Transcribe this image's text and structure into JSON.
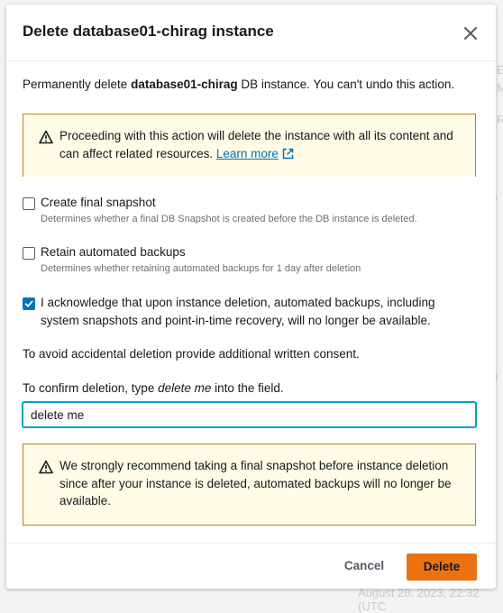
{
  "modal": {
    "title": "Delete database01-chirag instance",
    "intro_prefix": "Permanently delete ",
    "intro_instance": "database01-chirag",
    "intro_suffix": " DB instance. You can't undo this action.",
    "warning1": {
      "text": "Proceeding with this action will delete the instance with all its content and can affect related resources.",
      "link_label": "Learn more"
    },
    "options": [
      {
        "label": "Create final snapshot",
        "description": "Determines whether a final DB Snapshot is created before the DB instance is deleted.",
        "checked": false
      },
      {
        "label": "Retain automated backups",
        "description": "Determines whether retaining automated backups for 1 day after deletion",
        "checked": false
      },
      {
        "label": "I acknowledge that upon instance deletion, automated backups, including system snapshots and point-in-time recovery, will no longer be available.",
        "checked": true
      }
    ],
    "consent_text": "To avoid accidental deletion provide additional written consent.",
    "confirm_prefix": "To confirm deletion, type ",
    "confirm_phrase": "delete me",
    "confirm_suffix": " into the field.",
    "confirm_input_value": "delete me",
    "warning2": {
      "text": "We strongly recommend taking a final snapshot before instance deletion since after your instance is deleted, automated backups will no longer be available."
    },
    "cancel_label": "Cancel",
    "delete_label": "Delete"
  },
  "colors": {
    "primary_button": "#ec7211",
    "link": "#0073bb",
    "warning_bg": "#fffbe6",
    "warning_border": "#b8860b",
    "focus_ring": "#00a1c9"
  }
}
